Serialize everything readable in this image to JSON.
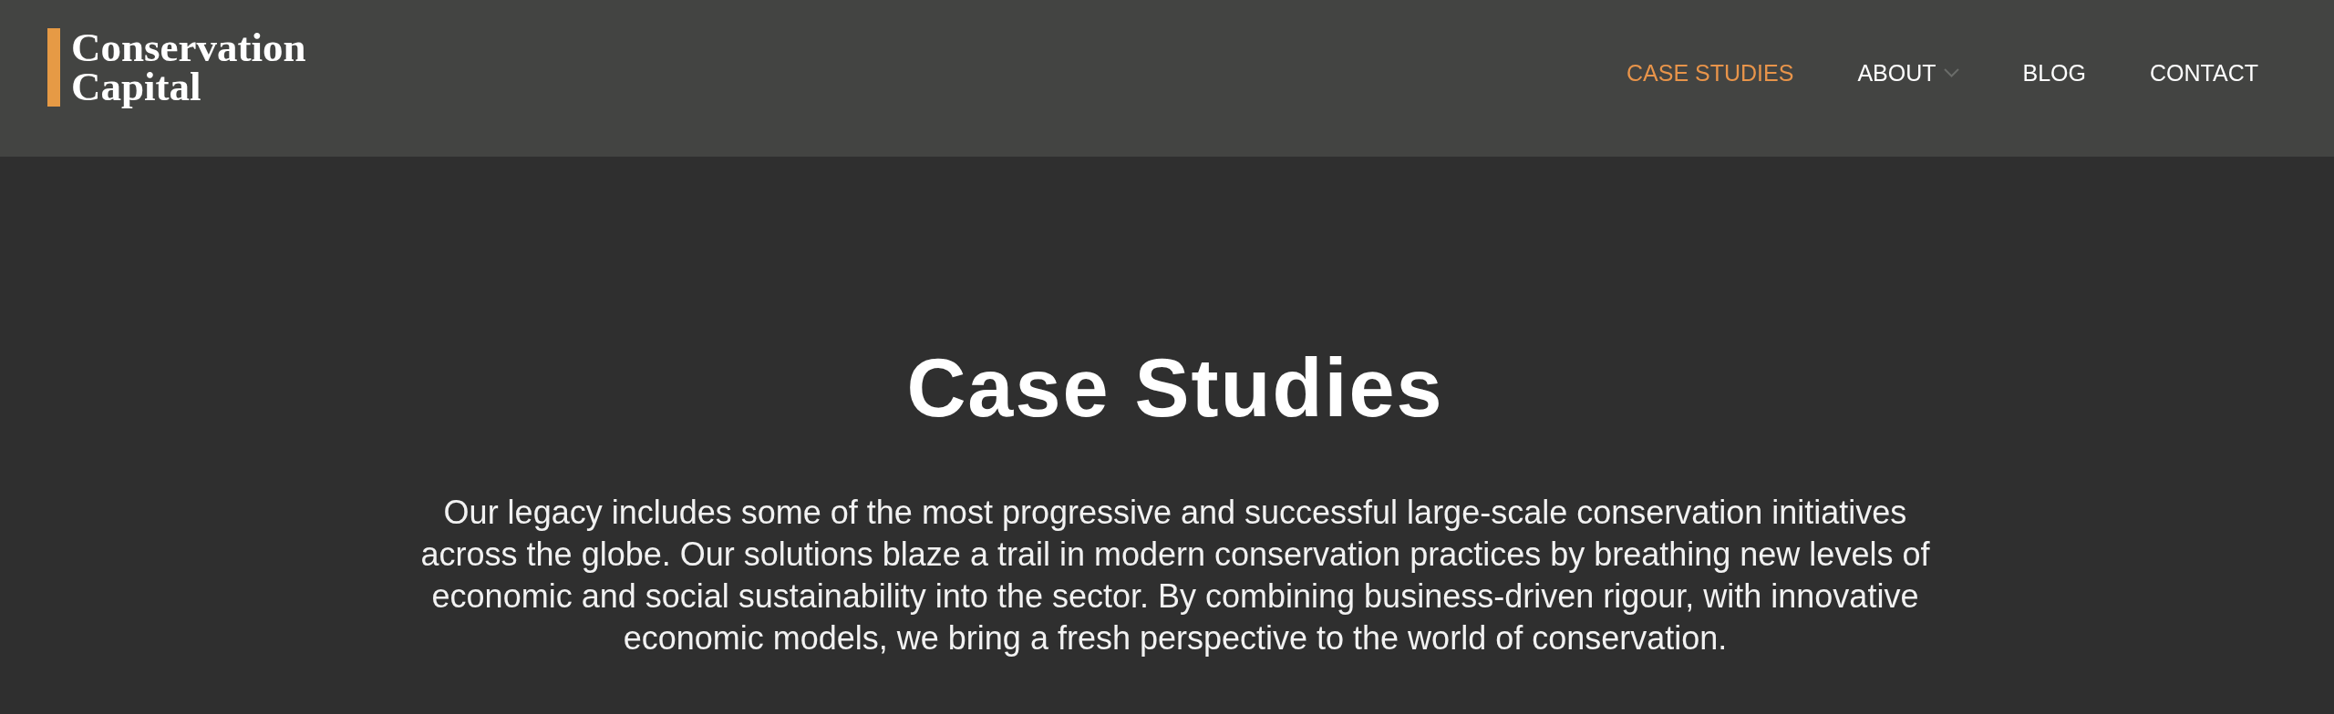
{
  "logo": {
    "text": "Conservation Capital"
  },
  "nav": [
    {
      "label": "CASE STUDIES",
      "selected": true,
      "kind": "link"
    },
    {
      "label": "ABOUT",
      "selected": false,
      "kind": "dropdown"
    },
    {
      "label": "BLOG",
      "selected": false,
      "kind": "link"
    },
    {
      "label": "CONTACT",
      "selected": false,
      "kind": "link"
    }
  ],
  "hero": {
    "title": "Case Studies",
    "intro": "Our legacy includes some of the most progressive and successful large-scale conservation initiatives across the globe. Our solutions blaze a trail in modern conservation practices by breathing new levels of economic and social sustainability into the sector. By combining business-driven rigour, with innovative economic models, we bring a fresh perspective to the world of conservation."
  }
}
